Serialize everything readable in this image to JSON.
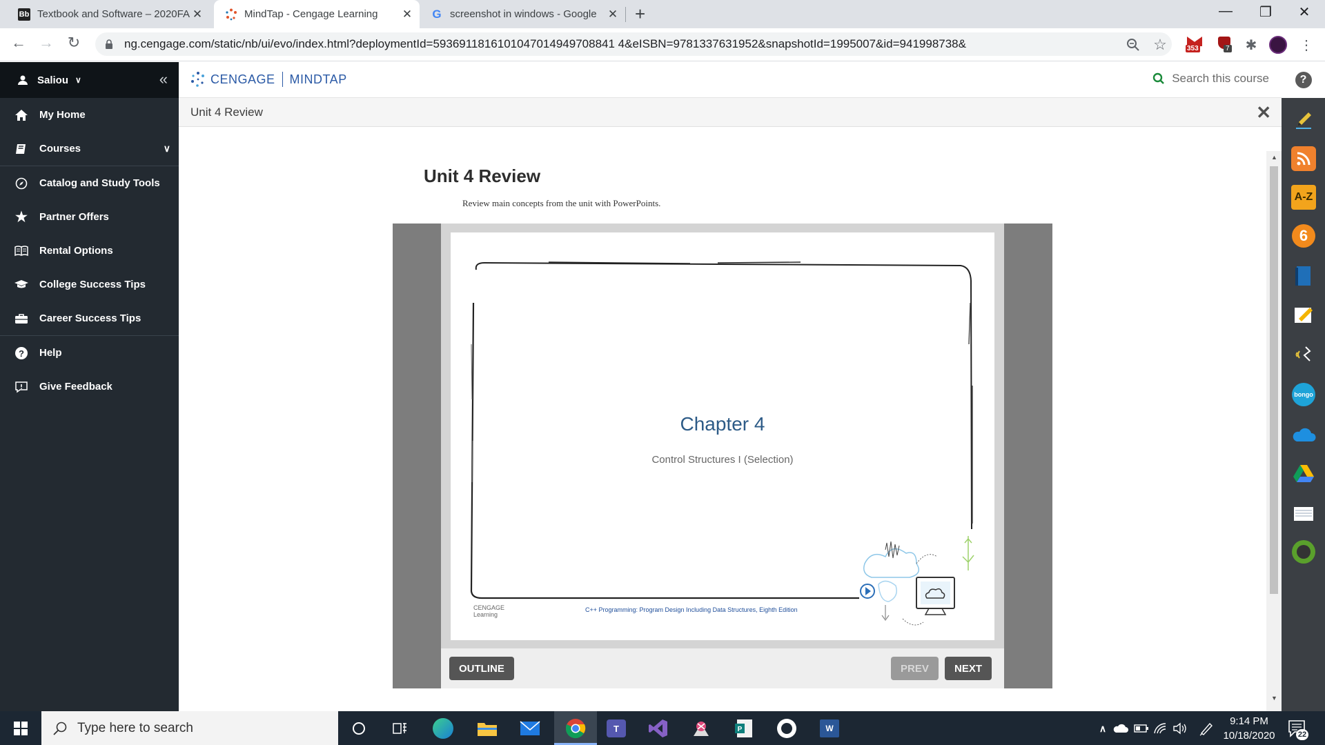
{
  "browser": {
    "tabs": [
      {
        "title": "Textbook and Software – 2020FA",
        "favicon": "Bb",
        "active": false
      },
      {
        "title": "MindTap - Cengage Learning",
        "favicon": "cengage-icon",
        "active": true
      },
      {
        "title": "screenshot in windows - Google",
        "favicon": "G",
        "active": false
      }
    ],
    "url": "ng.cengage.com/static/nb/ui/evo/index.html?deploymentId=5936911816101047014949708841 4&eISBN=9781337631952&snapshotId=1995007&id=941998738&",
    "gmail_badge": "353",
    "ext_badge": "7"
  },
  "sidebar": {
    "user": "Saliou",
    "items": [
      {
        "label": "My Home",
        "icon": "home-icon"
      },
      {
        "label": "Courses",
        "icon": "book-icon"
      },
      {
        "label": "Catalog and Study Tools",
        "icon": "compass-icon"
      },
      {
        "label": "Partner Offers",
        "icon": "star-icon"
      },
      {
        "label": "Rental Options",
        "icon": "open-book-icon"
      },
      {
        "label": "College Success Tips",
        "icon": "graduation-cap-icon"
      },
      {
        "label": "Career Success Tips",
        "icon": "briefcase-icon"
      },
      {
        "label": "Help",
        "icon": "question-icon"
      },
      {
        "label": "Give Feedback",
        "icon": "feedback-icon"
      }
    ]
  },
  "header": {
    "brand_left": "CENGAGE",
    "brand_right": "MINDTAP",
    "search_label": "Search this course"
  },
  "activity": {
    "header_title": "Unit 4 Review",
    "title": "Unit 4 Review",
    "subtitle": "Review main concepts from the unit with PowerPoints.",
    "slide": {
      "chapter": "Chapter 4",
      "chapter_subtitle": "Control Structures I (Selection)",
      "logo_line1": "CENGAGE",
      "logo_line2": "Learning",
      "footer_text": "C++ Programming: Program Design Including Data Structures, Eighth Edition"
    },
    "controls": {
      "outline": "OUTLINE",
      "prev": "PREV",
      "next": "NEXT"
    }
  },
  "taskbar": {
    "search_placeholder": "Type here to search",
    "time": "9:14 PM",
    "date": "10/18/2020",
    "notifications": "22"
  }
}
